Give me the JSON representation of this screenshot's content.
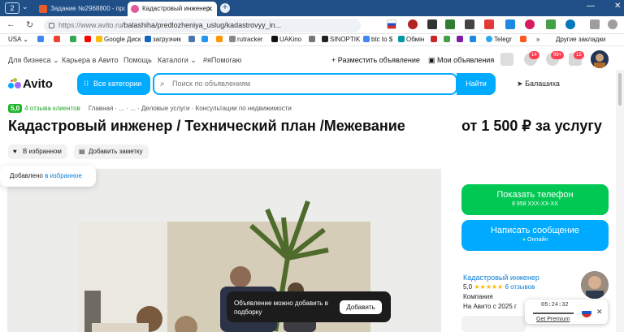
{
  "browser": {
    "tab_count": "2",
    "tabs": [
      {
        "label": "Задание №2968800 - про",
        "active": false
      },
      {
        "label": "Кадастровый инженер",
        "active": true
      }
    ],
    "url_host": "https://www.avito.ru",
    "url_path": "/balashiha/predlozheniya_uslug/kadastrovyy_in...",
    "bookmarks": [
      "USA",
      "Google Диск",
      "загрузчик",
      "rutracker",
      "UAKino",
      "SINOPTIK",
      "btc to $",
      "Обмін",
      "Telegr",
      "Другие закладки"
    ]
  },
  "avito": {
    "topnav": {
      "for_business": "Для бизнеса",
      "career": "Карьера в Авито",
      "help": "Помощь",
      "catalogs": "Каталоги",
      "pomogayu": "#яПомогаю",
      "post_ad": "Разместить объявление",
      "my_ads": "Мои объявления",
      "badges": [
        "14",
        "99+",
        "15"
      ]
    },
    "logo": "Avito",
    "categories_label": "Все категории",
    "search_placeholder": "Поиск по объявлениям",
    "search_button": "Найти",
    "location": "Балашиха",
    "rating_value": "5,0",
    "reviews_label": "4 отзыва клиентов",
    "breadcrumbs": "Главная · ... · ... · Деловые услуги · Консультации по недвижимости",
    "title": "Кадастровый инженер / Технический план /Межевание",
    "price": "от 1 500 ₽ за услугу",
    "favorite_label": "В избранном",
    "note_label": "Добавить заметку",
    "added_toast_prefix": "Добавлено",
    "added_toast_link": "в избранное",
    "show_phone": "Показать телефон",
    "phone_mask": "8 958 XXX-XX-XX",
    "write_message": "Написать сообщение",
    "online": "Онлайн",
    "seller": {
      "name": "Кадастровый инженер",
      "rating": "5,0",
      "stars": "★★★★★",
      "reviews": "6 отзывов",
      "type": "Компания",
      "since": "На Авито с 2025 г"
    },
    "compare_toast": "Объявление можно добавить в подборку",
    "compare_add": "Добавить",
    "player_time": "05:24:32",
    "player_link": "Get Premium"
  },
  "colors": {
    "accent_blue": "#00aaff",
    "accent_green": "#00c853",
    "tabbar": "#1f4f86"
  }
}
